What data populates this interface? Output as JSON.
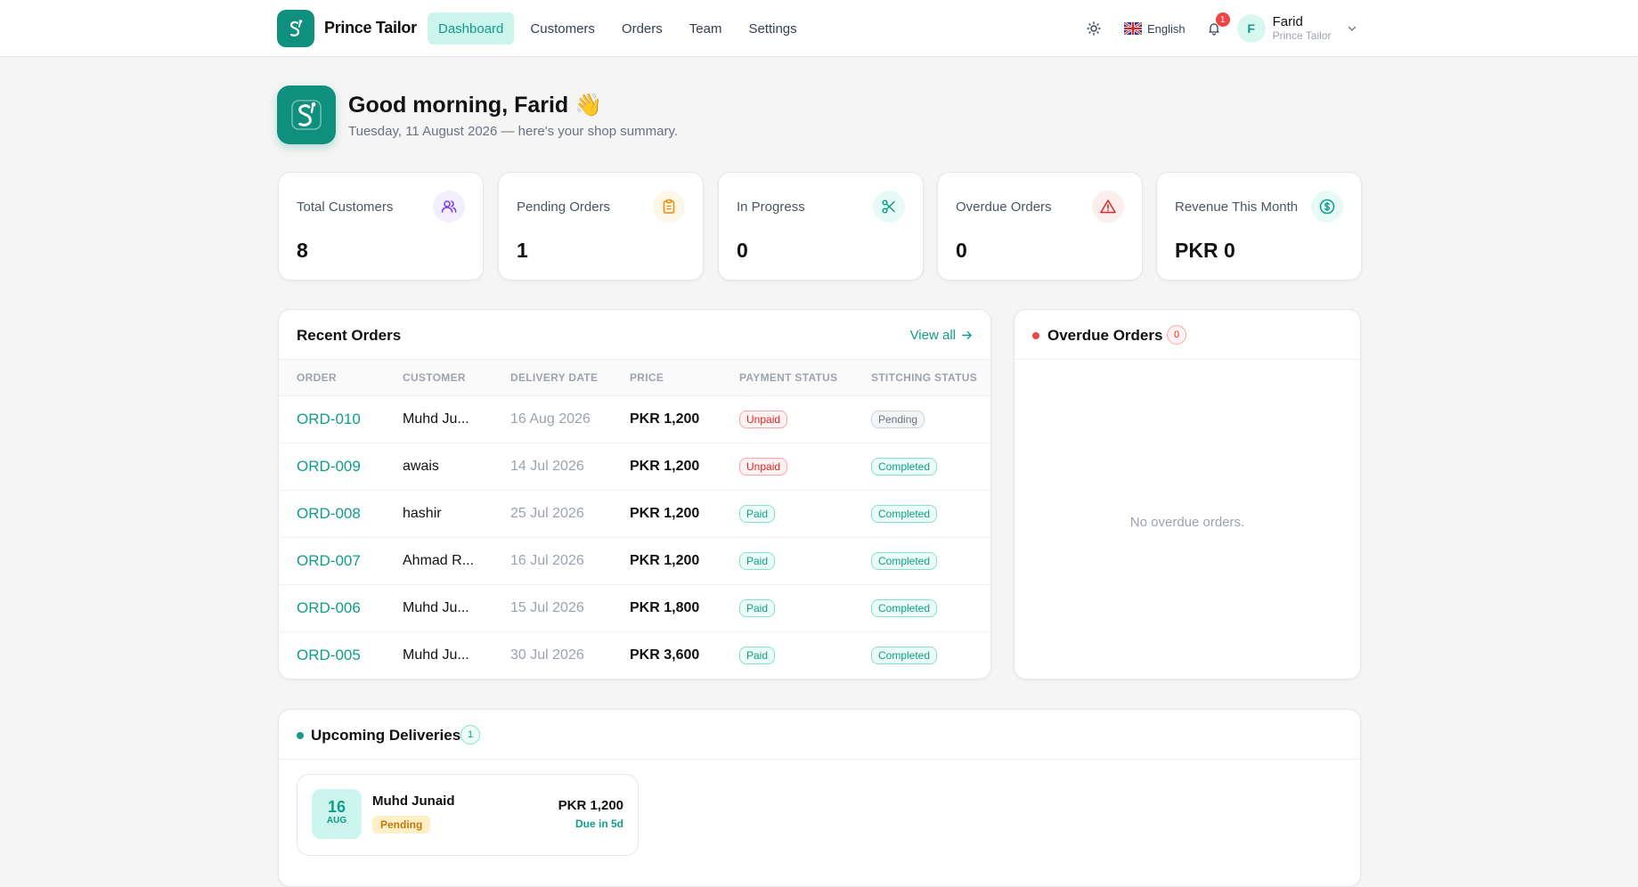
{
  "brand": {
    "name": "Prince Tailor"
  },
  "nav": {
    "items": [
      {
        "label": "Dashboard",
        "active": true
      },
      {
        "label": "Customers",
        "active": false
      },
      {
        "label": "Orders",
        "active": false
      },
      {
        "label": "Team",
        "active": false
      },
      {
        "label": "Settings",
        "active": false
      }
    ]
  },
  "header": {
    "language": "English",
    "notifications_count": "1",
    "user": {
      "initial": "F",
      "name": "Farid",
      "shop": "Prince Tailor"
    }
  },
  "greeting": {
    "title": "Good morning, Farid 👋",
    "subtitle": "Tuesday, 11 August 2026 — here's your shop summary."
  },
  "stats": [
    {
      "label": "Total Customers",
      "value": "8",
      "icon": "users-icon",
      "color": "#7c3aed",
      "bg": "#f3eefe"
    },
    {
      "label": "Pending Orders",
      "value": "1",
      "icon": "clipboard-icon",
      "color": "#ea8a0c",
      "bg": "#fef6e7"
    },
    {
      "label": "In Progress",
      "value": "0",
      "icon": "scissors-icon",
      "color": "#0f9d8a",
      "bg": "#e8faf6"
    },
    {
      "label": "Overdue Orders",
      "value": "0",
      "icon": "alert-triangle-icon",
      "color": "#dc2626",
      "bg": "#fdeeee"
    },
    {
      "label": "Revenue This Month",
      "value": "PKR 0",
      "icon": "dollar-circle-icon",
      "color": "#0f9d8a",
      "bg": "#e8faf6"
    }
  ],
  "recent_orders": {
    "title": "Recent Orders",
    "view_all": "View all",
    "columns": [
      "ORDER",
      "CUSTOMER",
      "DELIVERY DATE",
      "PRICE",
      "PAYMENT STATUS",
      "STITCHING STATUS"
    ],
    "rows": [
      {
        "order": "ORD-010",
        "customer": "Muhd Ju...",
        "date": "16 Aug 2026",
        "price": "PKR 1,200",
        "payment": "Unpaid",
        "stitching": "Pending"
      },
      {
        "order": "ORD-009",
        "customer": "awais",
        "date": "14 Jul 2026",
        "price": "PKR 1,200",
        "payment": "Unpaid",
        "stitching": "Completed"
      },
      {
        "order": "ORD-008",
        "customer": "hashir",
        "date": "25 Jul 2026",
        "price": "PKR 1,200",
        "payment": "Paid",
        "stitching": "Completed"
      },
      {
        "order": "ORD-007",
        "customer": "Ahmad R...",
        "date": "16 Jul 2026",
        "price": "PKR 1,200",
        "payment": "Paid",
        "stitching": "Completed"
      },
      {
        "order": "ORD-006",
        "customer": "Muhd Ju...",
        "date": "15 Jul 2026",
        "price": "PKR 1,800",
        "payment": "Paid",
        "stitching": "Completed"
      },
      {
        "order": "ORD-005",
        "customer": "Muhd Ju...",
        "date": "30 Jul 2026",
        "price": "PKR 3,600",
        "payment": "Paid",
        "stitching": "Completed"
      }
    ]
  },
  "overdue": {
    "title": "Overdue Orders",
    "count": "0",
    "empty_text": "No overdue orders."
  },
  "upcoming": {
    "title": "Upcoming Deliveries",
    "count": "1",
    "items": [
      {
        "day": "16",
        "month": "AUG",
        "customer": "Muhd Junaid",
        "status": "Pending",
        "price": "PKR 1,200",
        "due": "Due in 5d"
      }
    ]
  },
  "colors": {
    "accent": "#0f9d8a",
    "accent_dark": "#0f8f7e",
    "danger": "#ef4444"
  }
}
